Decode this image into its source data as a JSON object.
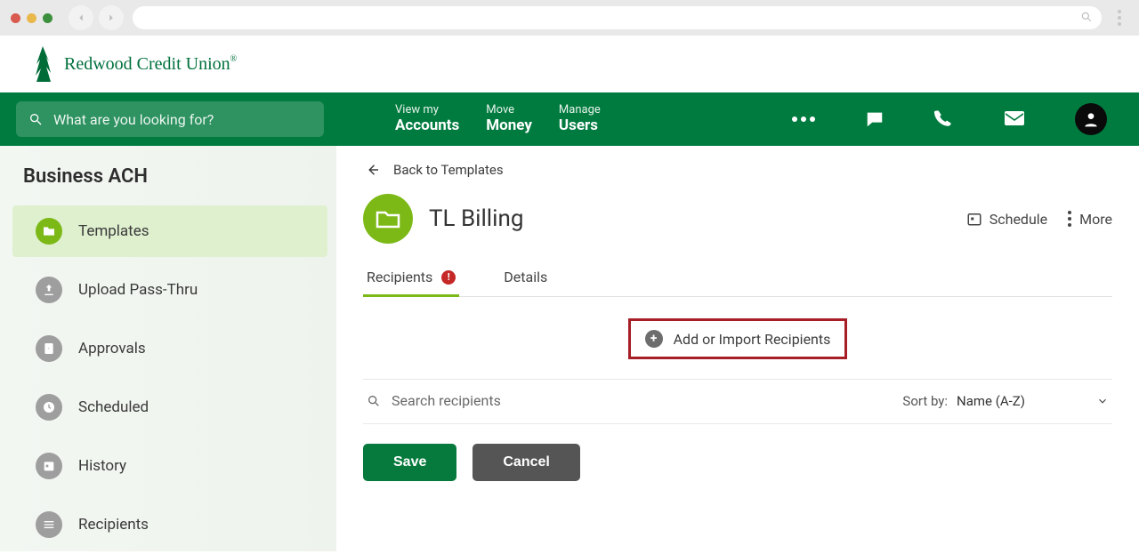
{
  "logo": {
    "name": "Redwood Credit Union"
  },
  "topNav": {
    "searchPlaceholder": "What are you looking for?",
    "items": [
      {
        "top": "View my",
        "bot": "Accounts"
      },
      {
        "top": "Move",
        "bot": "Money"
      },
      {
        "top": "Manage",
        "bot": "Users"
      }
    ]
  },
  "sidebar": {
    "heading": "Business ACH",
    "items": [
      {
        "label": "Templates",
        "icon": "folder-icon",
        "active": true
      },
      {
        "label": "Upload Pass-Thru",
        "icon": "upload-icon"
      },
      {
        "label": "Approvals",
        "icon": "check-clipboard-icon"
      },
      {
        "label": "Scheduled",
        "icon": "clock-icon"
      },
      {
        "label": "History",
        "icon": "calendar-day-icon"
      },
      {
        "label": "Recipients",
        "icon": "list-icon"
      }
    ]
  },
  "page": {
    "backLabel": "Back to Templates",
    "title": "TL Billing",
    "actions": {
      "schedule": "Schedule",
      "more": "More"
    },
    "tabs": [
      {
        "label": "Recipients",
        "active": true,
        "alert": "!"
      },
      {
        "label": "Details"
      }
    ],
    "addRecipients": "Add or Import Recipients",
    "searchPlaceholder": "Search recipients",
    "sort": {
      "label": "Sort by:",
      "value": "Name (A-Z)"
    },
    "buttons": {
      "save": "Save",
      "cancel": "Cancel"
    }
  }
}
